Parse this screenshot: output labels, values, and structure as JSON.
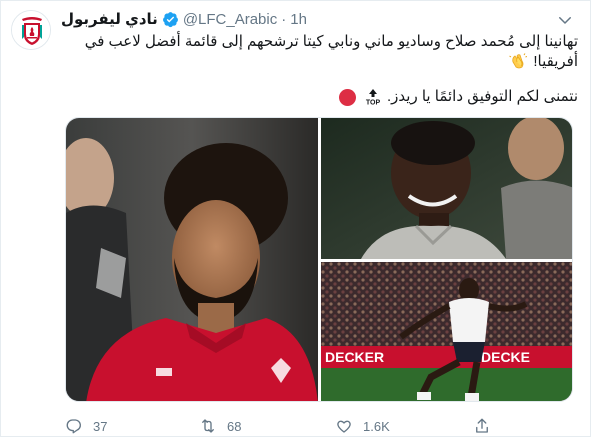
{
  "tweet": {
    "display_name": "نادي ليفربول",
    "handle": "@LFC_Arabic",
    "separator": "·",
    "time": "1h",
    "avatar_icon": "lfc-crest-icon",
    "text_line1": "تهانينا إلى مُحمد صلاح وساديو ماني ونابي كيتا ترشحهم إلى قائمة أفضل لاعب في",
    "text_line2": "أفريقيا!",
    "text_line2_emoji": "clapping-hands-icon",
    "text_line3": "نتمنى لكم التوفيق دائمًا يا ريدز.",
    "text_line3_emojis": [
      "top-arrow-icon",
      "red-circle-icon"
    ],
    "media": [
      {
        "description": "photo-salah"
      },
      {
        "description": "photo-keita"
      },
      {
        "description": "photo-mane"
      }
    ],
    "stats": {
      "replies": "37",
      "retweets": "68",
      "likes": "1.6K"
    }
  },
  "colors": {
    "text": "#14171a",
    "muted": "#657786",
    "verified": "#1da1f2",
    "lfc_red": "#c8102e",
    "border": "#e1e8ed"
  }
}
